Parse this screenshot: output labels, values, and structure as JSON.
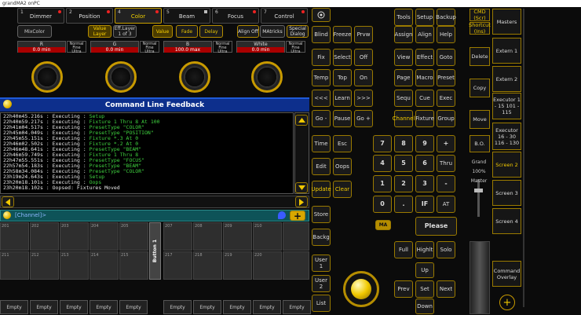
{
  "window_title": "grandMA2 onPC",
  "tabs": [
    {
      "num": "1",
      "label": "Dimmer"
    },
    {
      "num": "2",
      "label": "Position"
    },
    {
      "num": "4",
      "label": "Color"
    },
    {
      "num": "5",
      "label": "Beam"
    },
    {
      "num": "6",
      "label": "Focus"
    },
    {
      "num": "7",
      "label": "Control"
    }
  ],
  "feature_buttons": {
    "mixcolor": "MixColor",
    "value_layer": "Value Layer",
    "eff_layer": "Eff.Layer 1 of 3",
    "value": "Value",
    "fade": "Fade",
    "delay": "Delay",
    "align": "Align Off",
    "matricks": "MAtricks",
    "special": "Special Dialog"
  },
  "attrs": [
    {
      "name": "R",
      "value": "0.0 min",
      "mode": "Normal Fine Ultra"
    },
    {
      "name": "G",
      "value": "0.0 min",
      "mode": "Normal Fine Ultra"
    },
    {
      "name": "B",
      "value": "100.0 max",
      "mode": "Normal Fine Ultra"
    },
    {
      "name": "White",
      "value": "0.0 min",
      "mode": "Normal Fine Ultra"
    }
  ],
  "feedback": {
    "title": "Command Line Feedback",
    "lines": [
      {
        "t": "22h40m45.216s : Executing : ",
        "c": "Setup"
      },
      {
        "t": "22h40m59.217s : Executing : ",
        "c": "Fixture 1 Thru 8 At 100"
      },
      {
        "t": "22h41m04.517s : Executing : ",
        "c": "PresetType \"COLOR\""
      },
      {
        "t": "22h45m04.049s : Executing : ",
        "c": "PresetType \"POSITION\""
      },
      {
        "t": "22h45m55.151s : Executing : ",
        "c": "Fixture *.3 At 0"
      },
      {
        "t": "22h46m02.502s : Executing : ",
        "c": "Fixture *.2 At 0"
      },
      {
        "t": "22h46m48.641s : Executing : ",
        "c": "PresetType \"BEAM\""
      },
      {
        "t": "22h46m59.749s : Executing : ",
        "c": "Fixture 1 Thru 8"
      },
      {
        "t": "22h47m55.551s : Executing : ",
        "c": "PresetType \"FOCUS\""
      },
      {
        "t": "22h57m54.183s : Executing : ",
        "c": "PresetType \"BEAM\""
      },
      {
        "t": "22h58m34.084s : Executing : ",
        "c": "PresetType \"COLOR\""
      },
      {
        "t": "23h19m24.643s : Executing : ",
        "c": "Setup"
      },
      {
        "t": "23h20m18.101s : Executing : ",
        "c": "Oops"
      },
      {
        "t": "23h20m18.102s : Oopsed: Fixtures Moved",
        "c": ""
      }
    ]
  },
  "cmdline": "[Channel]>",
  "grid_row1": [
    "201",
    "202",
    "203",
    "204",
    "205",
    "",
    "207",
    "208",
    "209",
    "210"
  ],
  "grid_row2": [
    "211",
    "212",
    "213",
    "214",
    "215",
    "",
    "217",
    "218",
    "219",
    "220"
  ],
  "button_label": "Button 1",
  "empty_label": "Empty",
  "keys": {
    "blind": "Blind",
    "freeze": "Freeze",
    "prvw": "Prvw",
    "fix": "Fix",
    "select": "Select",
    "off": "Off",
    "temp": "Temp",
    "top": "Top",
    "on": "On",
    "prev3": "<<<",
    "learn": "Learn",
    "next3": ">>>",
    "gominus": "Go -",
    "pause": "Pause",
    "goplus": "Go +",
    "time": "Time",
    "esc": "Esc",
    "edit": "Edit",
    "oops": "Oops",
    "update": "Update",
    "clear": "Clear",
    "store": "Store",
    "backg": "Backg",
    "user1": "User 1",
    "user2": "User 2",
    "list": "List",
    "tools": "Tools",
    "setup": "Setup",
    "backup": "Backup",
    "assign": "Assign",
    "align": "Align",
    "help": "Help",
    "view": "View",
    "effect": "Effect",
    "goto": "Goto",
    "page": "Page",
    "macro": "Macro",
    "preset": "Preset",
    "sequ": "Sequ",
    "cue": "Cue",
    "exec": "Exec",
    "channel": "Channel",
    "fixture": "Fixture",
    "group": "Group",
    "k7": "7",
    "k8": "8",
    "k9": "9",
    "plus": "+",
    "k4": "4",
    "k5": "5",
    "k6": "6",
    "thru": "Thru",
    "k1": "1",
    "k2": "2",
    "k3": "3",
    "minus": "-",
    "k0": "0",
    "dot": ".",
    "if": "IF",
    "at": "AT",
    "ma": "MA",
    "please": "Please",
    "full": "Full",
    "highlt": "Highlt",
    "solo": "Solo",
    "up": "Up",
    "prev": "Prev",
    "set": "Set",
    "next": "Next",
    "down": "Down",
    "cmd": "CMD (Scr)",
    "shortcut": "Shortcut (Ins)",
    "delete": "Delete",
    "copy": "Copy",
    "move": "Move",
    "bo": "B.O.",
    "grand": "Grand",
    "grand_pct": "100%",
    "master": "Master"
  },
  "right_col": [
    "Masters",
    "Extern 1",
    "Extern 2",
    "Executor 1 - 15 101 - 115",
    "Executor 16 - 30 116 - 130",
    "Screen 2",
    "Screen 3",
    "Screen 4",
    "Command Overlay"
  ],
  "colors": {
    "accent": "#c89a00",
    "yellow": "#f0c800",
    "feedback_blue": "#0d2f8c",
    "value_red": "#aa0000",
    "green": "#3fd13f"
  }
}
